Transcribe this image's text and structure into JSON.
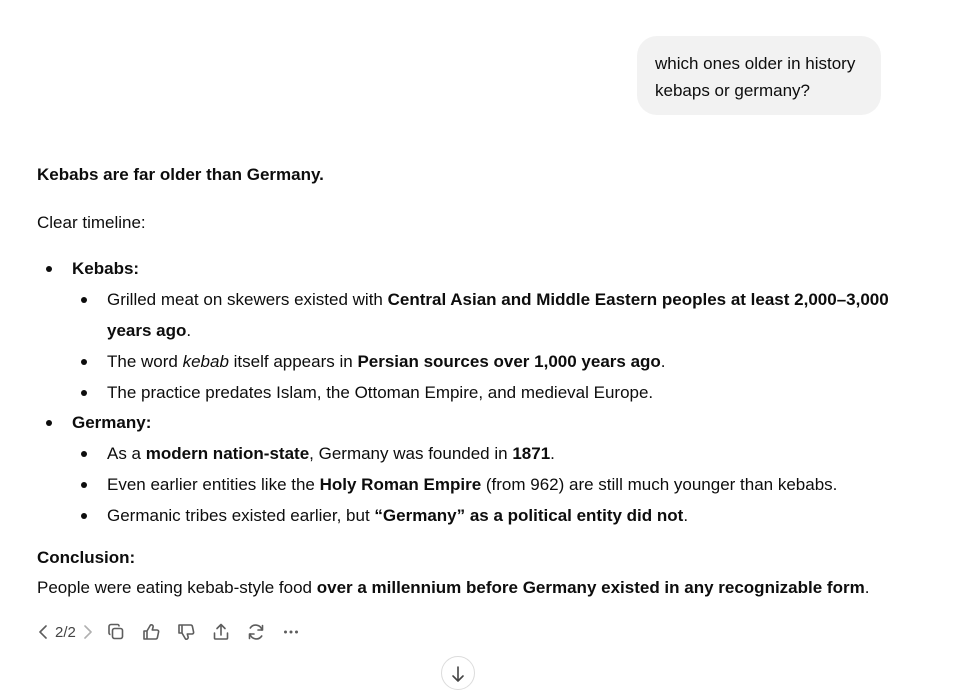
{
  "user_message": "which ones older in history kebaps or germany?",
  "answer": {
    "headline": "Kebabs are far older than Germany.",
    "intro": "Clear timeline:",
    "kebabs": {
      "label": "Kebabs:",
      "item1": {
        "pre": "Grilled meat on skewers existed with ",
        "bold": "Central Asian and Middle Eastern peoples at least 2,000–3,000 years ago",
        "post": "."
      },
      "item2": {
        "pre": "The word ",
        "italic": "kebab",
        "mid": " itself appears in ",
        "bold": "Persian sources over 1,000 years ago",
        "post": "."
      },
      "item3": "The practice predates Islam, the Ottoman Empire, and medieval Europe."
    },
    "germany": {
      "label": "Germany:",
      "item1": {
        "pre": "As a ",
        "bold1": "modern nation-state",
        "mid": ", Germany was founded in ",
        "bold2": "1871",
        "post": "."
      },
      "item2": {
        "pre": "Even earlier entities like the ",
        "bold": "Holy Roman Empire",
        "post": " (from 962) are still much younger than kebabs."
      },
      "item3": {
        "pre": "Germanic tribes existed earlier, but ",
        "bold": "“Germany” as a political entity did not",
        "post": "."
      }
    },
    "conclusion_title": "Conclusion:",
    "conclusion": {
      "pre": "People were eating kebab-style food ",
      "bold": "over a millennium before Germany existed in any recognizable form",
      "post": "."
    }
  },
  "toolbar": {
    "pager": "2/2",
    "icons": [
      "chevron-left-icon",
      "chevron-right-icon",
      "copy-icon",
      "thumbs-up-icon",
      "thumbs-down-icon",
      "share-icon",
      "regenerate-icon",
      "more-icon"
    ]
  }
}
